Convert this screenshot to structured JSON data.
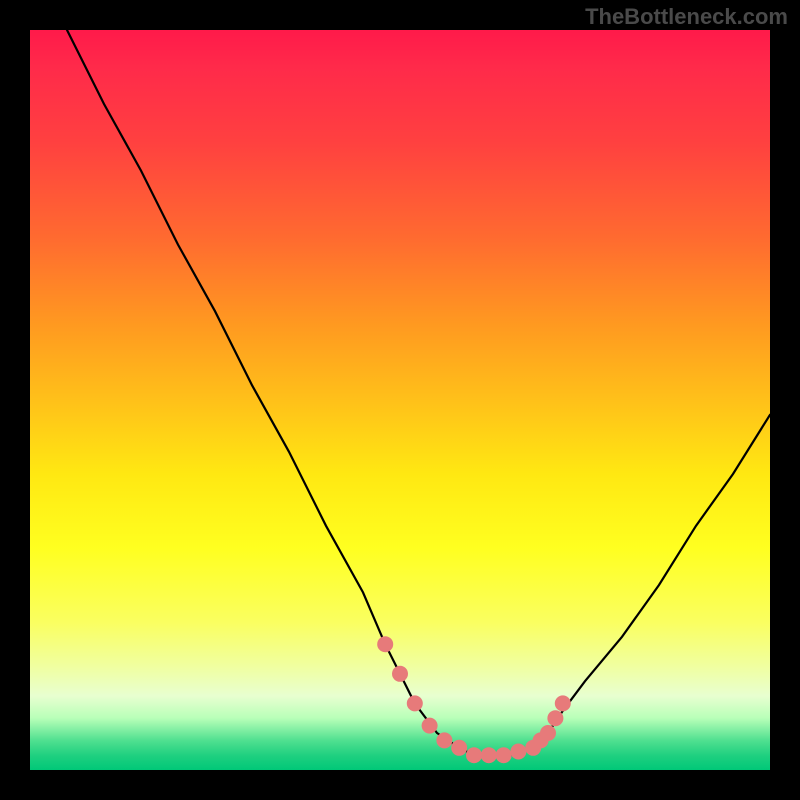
{
  "watermark": "TheBottleneck.com",
  "chart_data": {
    "type": "line",
    "title": "",
    "xlabel": "",
    "ylabel": "",
    "xlim": [
      0,
      100
    ],
    "ylim": [
      0,
      100
    ],
    "series": [
      {
        "name": "curve",
        "x": [
          5,
          10,
          15,
          20,
          25,
          30,
          35,
          40,
          45,
          48,
          50,
          52,
          55,
          58,
          60,
          62,
          65,
          68,
          70,
          72,
          75,
          80,
          85,
          90,
          95,
          100
        ],
        "y": [
          100,
          90,
          81,
          71,
          62,
          52,
          43,
          33,
          24,
          17,
          13,
          9,
          5,
          3,
          2,
          2,
          2,
          3,
          5,
          8,
          12,
          18,
          25,
          33,
          40,
          48
        ]
      },
      {
        "name": "dots",
        "x": [
          48,
          50,
          52,
          54,
          56,
          58,
          60,
          62,
          64,
          66,
          68,
          69,
          70,
          71,
          72
        ],
        "y": [
          17,
          13,
          9,
          6,
          4,
          3,
          2,
          2,
          2,
          2.5,
          3,
          4,
          5,
          7,
          9
        ]
      }
    ],
    "legend": false,
    "grid": false
  }
}
